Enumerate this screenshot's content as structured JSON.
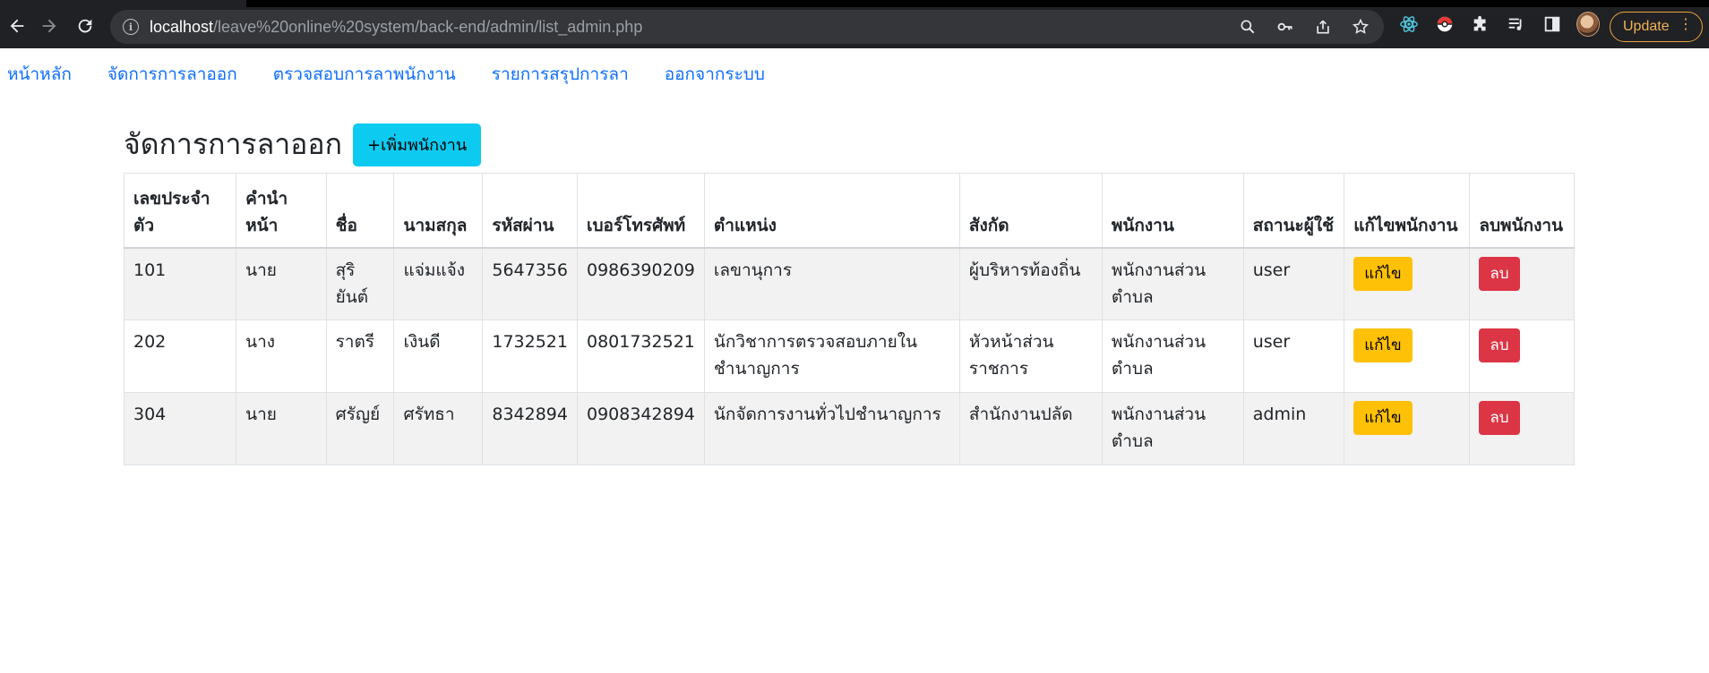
{
  "browser": {
    "url_host": "localhost",
    "url_path": "/leave%20online%20system/back-end/admin/list_admin.php",
    "update_label": "Update"
  },
  "nav": {
    "links": [
      "หน้าหลัก",
      "จัดการการลาออก",
      "ตรวจสอบการลาพนักงาน",
      "รายการสรุปการลา",
      "ออกจากระบบ"
    ]
  },
  "page": {
    "title": "จัดการการลาออก",
    "add_button": "+เพิ่มพนักงาน"
  },
  "table": {
    "headers": [
      "เลขประจำตัว",
      "คำนำหน้า",
      "ชื่อ",
      "นามสกุล",
      "รหัสผ่าน",
      "เบอร์โทรศัพท์",
      "ตำแหน่ง",
      "สังกัด",
      "พนักงาน",
      "สถานะผู้ใช้",
      "แก้ไขพนักงาน",
      "ลบพนักงาน"
    ],
    "rows": [
      {
        "id": "101",
        "prefix": "นาย",
        "name": "สุริยันต์",
        "surname": "แจ่มแจ้ง",
        "password": "5647356",
        "phone": "0986390209",
        "position": "เลขานุการ",
        "department": "ผู้บริหารท้องถิ่น",
        "employee": "พนักงานส่วนตำบล",
        "status": "user",
        "edit": "แก้ไข",
        "delete": "ลบ"
      },
      {
        "id": "202",
        "prefix": "นาง",
        "name": "ราตรี",
        "surname": "เงินดี",
        "password": "1732521",
        "phone": "0801732521",
        "position": "นักวิชาการตรวจสอบภายในชำนาญการ",
        "department": "หัวหน้าส่วนราชการ",
        "employee": "พนักงานส่วนตำบล",
        "status": "user",
        "edit": "แก้ไข",
        "delete": "ลบ"
      },
      {
        "id": "304",
        "prefix": "นาย",
        "name": "ศรัญย์",
        "surname": "ศรัทธา",
        "password": "8342894",
        "phone": "0908342894",
        "position": "นักจัดการงานทั่วไปชำนาญการ",
        "department": "สำนักงานปลัด",
        "employee": "พนักงานส่วนตำบล",
        "status": "admin",
        "edit": "แก้ไข",
        "delete": "ลบ"
      }
    ]
  }
}
